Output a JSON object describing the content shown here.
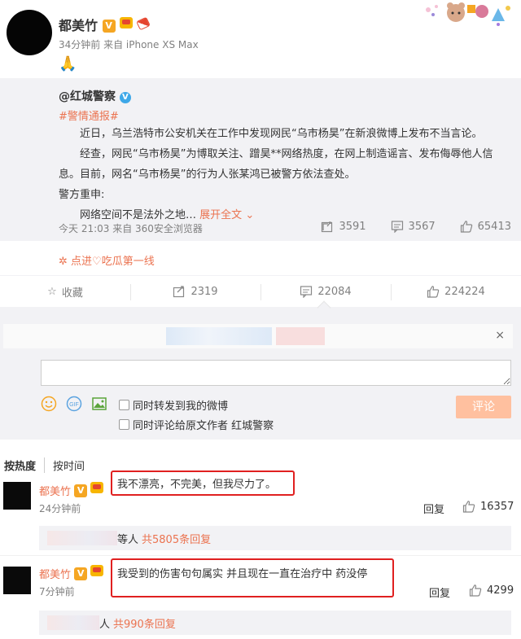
{
  "post": {
    "username": "都美竹",
    "v_badge": "V",
    "meta": "34分钟前 来自 iPhone XS Max",
    "content_emoji": "🙏"
  },
  "repost": {
    "user": "@红城警察",
    "tag": "#警情通报#",
    "para1": "近日，乌兰浩特市公安机关在工作中发现网民“乌市杨昊”在新浪微博上发布不当言论。",
    "para2": "经查，网民“乌市杨昊”为博取关注、蹭昊**网络热度，在网上制造谣言、发布侮辱他人信息。目前，网名“乌市杨昊”的行为人张某鸿已被警方依法查处。",
    "para3": "警方重申:",
    "para4_text": "网络空间不是法外之地…",
    "expand": "展开全文",
    "meta": "今天 21:03 来自 360安全浏览器",
    "reposts": "3591",
    "comments": "3567",
    "likes": "65413"
  },
  "source_link": "点进♡吃瓜第一线",
  "actions": {
    "favorite": "收藏",
    "reposts": "2319",
    "comments": "22084",
    "likes": "224224"
  },
  "composer": {
    "close": "×",
    "opt1": "同时转发到我的微博",
    "opt2": "同时评论给原文作者 红城警察",
    "submit": "评论"
  },
  "sort": {
    "hot": "按热度",
    "time": "按时间"
  },
  "comments": [
    {
      "user": "都美竹",
      "text": "我不漂亮，不完美，但我尽力了。",
      "time": "24分钟前",
      "reply": "回复",
      "likes": "16357",
      "sub_suffix": "等人",
      "sub_link": "共5805条回复"
    },
    {
      "user": "都美竹",
      "text": "我受到的伤害句句属实 并且现在一直在治疗中 药没停",
      "time": "7分钟前",
      "reply": "回复",
      "likes": "4299",
      "sub_suffix": "人",
      "sub_link": "共990条回复"
    }
  ],
  "colors": {
    "accent": "#eb7350",
    "highlight_border": "#e02020",
    "submit_bg": "#ffc09f",
    "panel_bg": "#f2f2f5"
  }
}
